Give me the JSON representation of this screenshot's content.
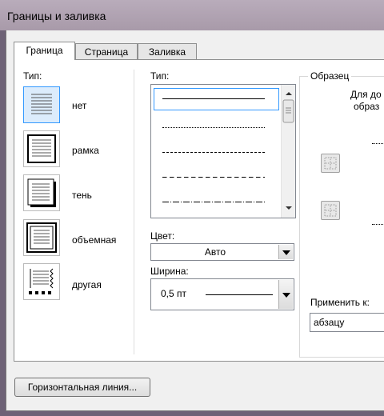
{
  "window": {
    "title": "Границы и заливка"
  },
  "tabs": [
    {
      "label": "Граница"
    },
    {
      "label": "Страница"
    },
    {
      "label": "Заливка"
    }
  ],
  "type_section": {
    "label": "Тип:",
    "options": [
      {
        "label": "нет",
        "selected": true
      },
      {
        "label": "рамка",
        "selected": false
      },
      {
        "label": "тень",
        "selected": false
      },
      {
        "label": "объемная",
        "selected": false
      },
      {
        "label": "другая",
        "selected": false
      }
    ]
  },
  "line_style": {
    "label": "Тип:",
    "styles": [
      "solid",
      "dotted",
      "dashed-fine",
      "dashed",
      "dash-dot"
    ],
    "selected": "solid"
  },
  "color": {
    "label": "Цвет:",
    "value": "Авто"
  },
  "width": {
    "label": "Ширина:",
    "value": "0,5 пт"
  },
  "preview": {
    "label": "Образец",
    "hint_line1": "Для до",
    "hint_line2": "образ"
  },
  "apply_to": {
    "label": "Применить к:",
    "value": "абзацу"
  },
  "buttons": {
    "horizontal_line": "Горизонтальная линия..."
  },
  "colors": {
    "selection_border": "#3399ff",
    "selection_fill": "#dcecfc"
  }
}
